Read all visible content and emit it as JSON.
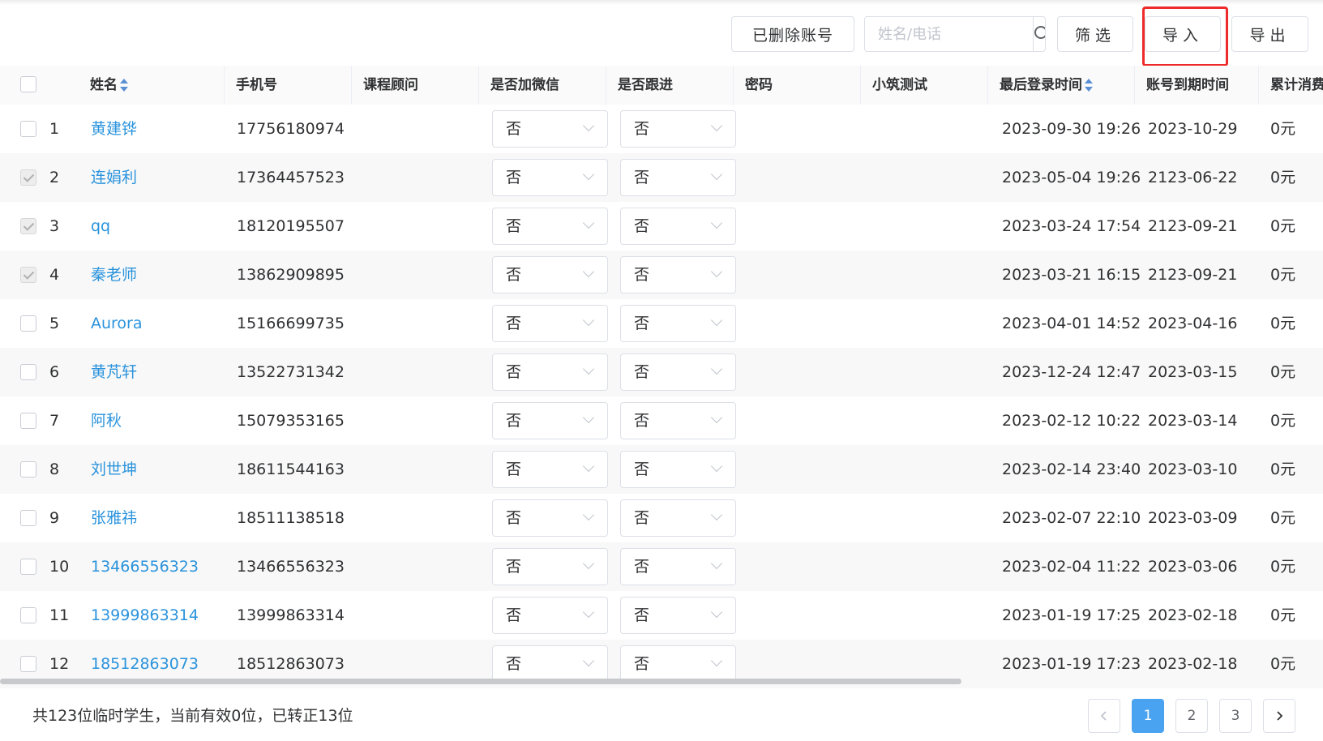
{
  "toolbar": {
    "deleted_label": "已删除账号",
    "search_placeholder": "姓名/电话",
    "filter_label": "筛选",
    "import_label": "导入",
    "export_label": "导出"
  },
  "columns": {
    "name": "姓名",
    "phone": "手机号",
    "advisor": "课程顾问",
    "wechat": "是否加微信",
    "follow": "是否跟进",
    "password": "密码",
    "test": "小筑测试",
    "last_login": "最后登录时间",
    "expire": "账号到期时间",
    "spend": "累计消费"
  },
  "rows": [
    {
      "index": "1",
      "name": "黄建铧",
      "phone": "17756180974",
      "wechat": "否",
      "follow": "否",
      "last_login": "2023-09-30 19:26",
      "expire": "2023-10-29",
      "spend": "0元",
      "checked": false
    },
    {
      "index": "2",
      "name": "连娟利",
      "phone": "17364457523",
      "wechat": "否",
      "follow": "否",
      "last_login": "2023-05-04 19:26",
      "expire": "2123-06-22",
      "spend": "0元",
      "checked": true
    },
    {
      "index": "3",
      "name": "qq",
      "phone": "18120195507",
      "wechat": "否",
      "follow": "否",
      "last_login": "2023-03-24 17:54",
      "expire": "2123-09-21",
      "spend": "0元",
      "checked": true
    },
    {
      "index": "4",
      "name": "秦老师",
      "phone": "13862909895",
      "wechat": "否",
      "follow": "否",
      "last_login": "2023-03-21 16:15",
      "expire": "2123-09-21",
      "spend": "0元",
      "checked": true
    },
    {
      "index": "5",
      "name": "Aurora",
      "phone": "15166699735",
      "wechat": "否",
      "follow": "否",
      "last_login": "2023-04-01 14:52",
      "expire": "2023-04-16",
      "spend": "0元",
      "checked": false
    },
    {
      "index": "6",
      "name": "黄芃轩",
      "phone": "13522731342",
      "wechat": "否",
      "follow": "否",
      "last_login": "2023-12-24 12:47",
      "expire": "2023-03-15",
      "spend": "0元",
      "checked": false
    },
    {
      "index": "7",
      "name": "阿秋",
      "phone": "15079353165",
      "wechat": "否",
      "follow": "否",
      "last_login": "2023-02-12 10:22",
      "expire": "2023-03-14",
      "spend": "0元",
      "checked": false
    },
    {
      "index": "8",
      "name": "刘世坤",
      "phone": "18611544163",
      "wechat": "否",
      "follow": "否",
      "last_login": "2023-02-14 23:40",
      "expire": "2023-03-10",
      "spend": "0元",
      "checked": false
    },
    {
      "index": "9",
      "name": "张雅祎",
      "phone": "18511138518",
      "wechat": "否",
      "follow": "否",
      "last_login": "2023-02-07 22:10",
      "expire": "2023-03-09",
      "spend": "0元",
      "checked": false
    },
    {
      "index": "10",
      "name": "13466556323",
      "phone": "13466556323",
      "wechat": "否",
      "follow": "否",
      "last_login": "2023-02-04 11:22",
      "expire": "2023-03-06",
      "spend": "0元",
      "checked": false
    },
    {
      "index": "11",
      "name": "13999863314",
      "phone": "13999863314",
      "wechat": "否",
      "follow": "否",
      "last_login": "2023-01-19 17:25",
      "expire": "2023-02-18",
      "spend": "0元",
      "checked": false
    },
    {
      "index": "12",
      "name": "18512863073",
      "phone": "18512863073",
      "wechat": "否",
      "follow": "否",
      "last_login": "2023-01-19 17:23",
      "expire": "2023-02-18",
      "spend": "0元",
      "checked": false
    }
  ],
  "footer": {
    "summary": "共123位临时学生，当前有效0位，已转正13位"
  },
  "pagination": {
    "pages": [
      "1",
      "2",
      "3"
    ],
    "current": "1"
  }
}
